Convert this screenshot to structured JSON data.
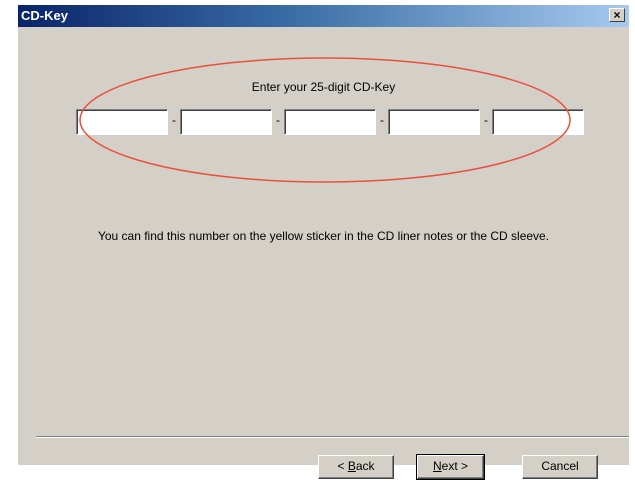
{
  "window": {
    "title": "CD-Key",
    "close_glyph": "×"
  },
  "prompt": "Enter your 25-digit CD-Key",
  "key_fields": [
    "",
    "",
    "",
    "",
    ""
  ],
  "separator_glyph": "-",
  "info_text": "You can find this number on the yellow sticker in the CD liner notes or the CD sleeve.",
  "buttons": {
    "back": {
      "prefix": "< ",
      "mnemonic": "B",
      "rest": "ack"
    },
    "next": {
      "prefix": "",
      "mnemonic": "N",
      "rest": "ext >"
    },
    "cancel": {
      "label": "Cancel"
    }
  },
  "colors": {
    "dialog_bg": "#d4d0c8",
    "titlebar_start": "#0a246a",
    "titlebar_end": "#a6caf0",
    "highlight_ellipse": "#e8503c"
  }
}
